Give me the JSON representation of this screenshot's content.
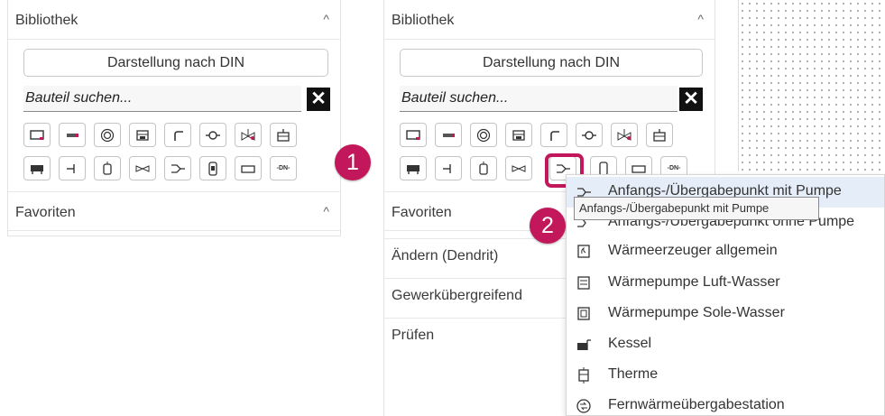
{
  "left_panel": {
    "library_title": "Bibliothek",
    "din_button": "Darstellung nach DIN",
    "search_value": "Bauteil suchen...",
    "clear_label": "✕",
    "favorites_title": "Favoriten",
    "chevron": "^"
  },
  "right_panel": {
    "library_title": "Bibliothek",
    "din_button": "Darstellung nach DIN",
    "search_value": "Bauteil suchen...",
    "clear_label": "✕",
    "favorites_title": "Favoriten",
    "chevron": "^",
    "tabs": [
      "Ändern (Dendrit)",
      "Gewerkübergreifend",
      "Prüfen"
    ]
  },
  "badges": {
    "step1": "1",
    "step2": "2"
  },
  "dropdown": {
    "items": [
      {
        "label": "Anfangs-/Übergabepunkt mit Pumpe",
        "icon": "pump-start-icon"
      },
      {
        "label": "Anfangs-/Übergabepunkt ohne Pumpe",
        "icon": "start-point-icon"
      },
      {
        "label": "Wärmeerzeuger allgemein",
        "icon": "heat-generator-icon"
      },
      {
        "label": "Wärmepumpe Luft-Wasser",
        "icon": "heat-pump-air-icon"
      },
      {
        "label": "Wärmepumpe Sole-Wasser",
        "icon": "heat-pump-brine-icon"
      },
      {
        "label": "Kessel",
        "icon": "boiler-icon"
      },
      {
        "label": "Therme",
        "icon": "therme-icon"
      },
      {
        "label": "Fernwärmeübergabestation",
        "icon": "district-heating-icon"
      }
    ]
  },
  "tooltip": "Anfangs-/Übergabepunkt mit Pumpe",
  "toolbar_icons_row1": [
    "radiator-icon",
    "strip-icon",
    "circle-target-icon",
    "valve-box-icon",
    "pipe-bend-icon",
    "pump-icon",
    "mixer-valve-icon",
    "storage-tank-icon"
  ],
  "toolbar_icons_row2": [
    "heater-icon",
    "junction-icon",
    "vessel-icon",
    "double-valve-icon",
    "transfer-point-icon",
    "cylinder-icon",
    "rectangle-icon",
    "dn-label-icon"
  ],
  "toolbar_dn_label": "-DN-",
  "accent": "#c2185b"
}
